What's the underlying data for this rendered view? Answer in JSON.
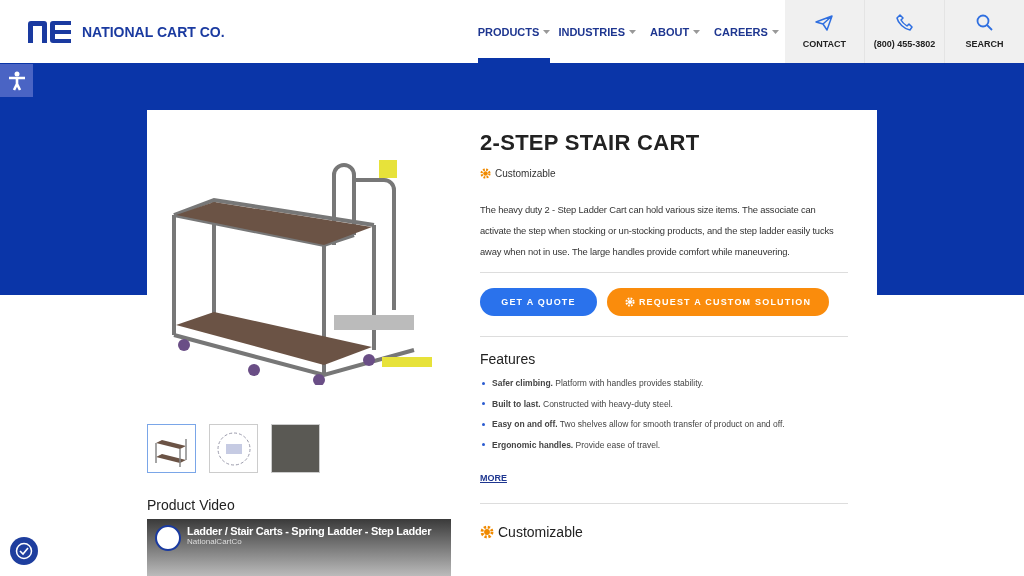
{
  "brand": {
    "name": "NATIONAL CART CO."
  },
  "nav": [
    {
      "label": "PRODUCTS",
      "selected": true
    },
    {
      "label": "INDUSTRIES",
      "selected": false
    },
    {
      "label": "ABOUT",
      "selected": false
    },
    {
      "label": "CAREERS",
      "selected": false
    }
  ],
  "utility": [
    {
      "kind": "contact",
      "label": "CONTACT"
    },
    {
      "kind": "phone",
      "label": "(800) 455-3802"
    },
    {
      "kind": "search",
      "label": "SEARCH"
    }
  ],
  "product": {
    "title": "2-STEP STAIR CART",
    "badge": "Customizable",
    "description": "The heavy duty 2 - Step Ladder Cart can hold various size items. The associate can activate the step when stocking or un-stocking products, and the step ladder easily tucks away when not in use. The large handles provide comfort while maneuvering.",
    "buttons": [
      {
        "kind": "primary",
        "label": "GET A QUOTE"
      },
      {
        "kind": "custom",
        "label": "REQUEST A CUSTOM SOLUTION"
      }
    ],
    "features_title": "Features",
    "features": [
      "**Safer climbing.** Platform with handles provides stability.",
      "**Built to last.** Constructed with heavy-duty steel.",
      "**Easy on and off.** Two shelves allow for smooth transfer of product on and off.",
      "**Ergonomic handles.** Provide ease of travel."
    ],
    "more": "MORE",
    "section_title": "Customizable"
  },
  "thumbnails": [
    {
      "kind": "cart",
      "selected": true
    },
    {
      "kind": "diagram",
      "selected": false
    },
    {
      "kind": "photo",
      "selected": false
    }
  ],
  "video": {
    "heading": "Product Video",
    "title": "Ladder / Stair Carts - Spring Ladder - Step Ladder",
    "channel": "NationalCartCo"
  }
}
